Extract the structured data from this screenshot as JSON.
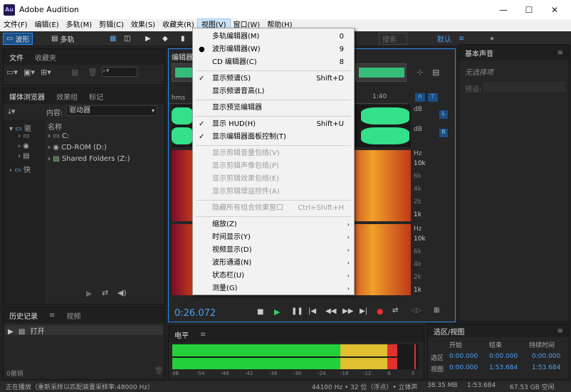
{
  "window": {
    "title": "Adobe Audition",
    "logo": "Au",
    "minimize": "—",
    "maximize": "☐",
    "close": "✕"
  },
  "menubar": [
    "文件(F)",
    "编辑(E)",
    "多轨(M)",
    "剪辑(C)",
    "效果(S)",
    "收藏夹(R)",
    "视图(V)",
    "窗口(W)",
    "帮助(H)"
  ],
  "toolbar": {
    "waveform": "波形",
    "multitrack": "多轨",
    "default": "默认",
    "search": "搜索"
  },
  "files_panel": {
    "tab1": "文件",
    "tab2": "收藏夹"
  },
  "media_panel": {
    "tab1": "媒体浏览器",
    "tab2": "效果组",
    "tab3": "标记",
    "content_label": "内容:",
    "content_value": "驱动器",
    "name_col": "名称",
    "left_items": [
      "驱",
      "快"
    ],
    "drives": [
      "C:",
      "CD-ROM (D:)",
      "Shared Folders (Z:)"
    ]
  },
  "editor": {
    "tab": "编辑器",
    "time_units": "hms",
    "ruler_mark": "1:40",
    "time": "0:26.072",
    "db_label": "dB",
    "hz_label": "Hz",
    "ch_l": "L",
    "ch_r": "R",
    "freq_top": [
      "10k",
      "6k",
      "4k",
      "2k",
      "1k"
    ],
    "freq_bot": [
      "10k",
      "6k",
      "4k",
      "2k",
      "1k"
    ]
  },
  "view_menu": {
    "items": [
      {
        "label": "多轨编辑器(M)",
        "shortcut": "0",
        "mark": "",
        "disabled": false
      },
      {
        "label": "波形编辑器(W)",
        "shortcut": "9",
        "mark": "●",
        "disabled": false
      },
      {
        "label": "CD 编辑器(C)",
        "shortcut": "8",
        "mark": "",
        "disabled": false
      },
      {
        "label": "显示频谱(S)",
        "shortcut": "Shift+D",
        "mark": "✓",
        "disabled": false
      },
      {
        "label": "显示频谱音高(L)",
        "shortcut": "",
        "mark": "",
        "disabled": false
      },
      {
        "label": "显示预览编辑器",
        "shortcut": "",
        "mark": "",
        "disabled": false
      },
      {
        "label": "显示 HUD(H)",
        "shortcut": "Shift+U",
        "mark": "✓",
        "disabled": false
      },
      {
        "label": "显示编辑器面板控制(T)",
        "shortcut": "",
        "mark": "✓",
        "disabled": false
      },
      {
        "label": "显示剪辑音量包络(V)",
        "shortcut": "",
        "mark": "",
        "disabled": true
      },
      {
        "label": "显示剪辑声像包络(P)",
        "shortcut": "",
        "mark": "",
        "disabled": true
      },
      {
        "label": "显示剪辑效果包络(E)",
        "shortcut": "",
        "mark": "",
        "disabled": true
      },
      {
        "label": "显示剪辑增益控件(A)",
        "shortcut": "",
        "mark": "",
        "disabled": true
      },
      {
        "label": "隐藏所有组合效果窗口",
        "shortcut": "Ctrl+Shift+H",
        "mark": "",
        "disabled": true
      },
      {
        "label": "缩放(Z)",
        "shortcut": "",
        "mark": "",
        "disabled": false
      },
      {
        "label": "时间显示(Y)",
        "shortcut": "",
        "mark": "",
        "disabled": false
      },
      {
        "label": "视频显示(D)",
        "shortcut": "",
        "mark": "",
        "disabled": false
      },
      {
        "label": "波形通道(N)",
        "shortcut": "",
        "mark": "",
        "disabled": false
      },
      {
        "label": "状态栏(U)",
        "shortcut": "",
        "mark": "",
        "disabled": false
      },
      {
        "label": "测量(G)",
        "shortcut": "",
        "mark": "",
        "disabled": false
      }
    ]
  },
  "essential_sound": {
    "tab": "基本声音",
    "no_selection": "无选择项",
    "preset": "预设:"
  },
  "history_panel": {
    "tab1": "历史记录",
    "tab2": "视频",
    "item": "打开",
    "undo": "0撤销"
  },
  "levels_panel": {
    "tab": "电平",
    "scale": [
      "dB",
      "-54",
      "-48",
      "-42",
      "-36",
      "-30",
      "-24",
      "-18",
      "-12",
      "-6",
      "0"
    ]
  },
  "selection_panel": {
    "tab": "选区/视图",
    "col_start": "开始",
    "col_end": "结束",
    "col_duration": "持续时间",
    "row_sel": "选区",
    "row_view": "视图",
    "sel_start": "0:00.000",
    "sel_end": "0:00.000",
    "sel_dur": "0:00.000",
    "view_start": "0:00.000",
    "view_end": "1:53.684",
    "view_dur": "1:53.684"
  },
  "status": {
    "left": "正在播放（重新采样以匹配装置采样率:48000 Hz）",
    "sample": "44100 Hz • 32 位（浮点）• 立体声",
    "mem": "38.35 MB",
    "dur": "1:53.684",
    "disk": "67.53 GB 空闲"
  },
  "colors": {
    "wave": "#35e08b",
    "accent": "#2b8cf0",
    "meter_green": "#22d13a",
    "meter_yellow": "#e0c030",
    "meter_red": "#e03030"
  }
}
